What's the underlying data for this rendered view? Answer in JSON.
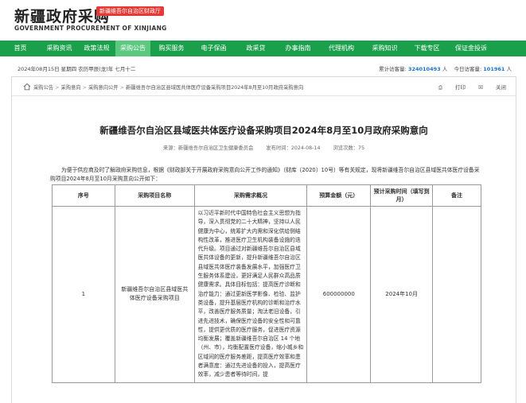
{
  "header": {
    "logo_cn": "新疆政府采购",
    "logo_badge": "新疆维吾尔自治区财政厅",
    "logo_en": "GOVERNMENT PROCUREMENT OF XINJIANG"
  },
  "nav": [
    {
      "label": "首页",
      "active": false
    },
    {
      "label": "采购资讯",
      "active": false
    },
    {
      "label": "政策法规",
      "active": false
    },
    {
      "label": "采购公告",
      "active": true
    },
    {
      "label": "购买服务",
      "active": false
    },
    {
      "label": "电子保函",
      "active": false
    },
    {
      "label": "政采贷",
      "active": false
    },
    {
      "label": "办事指南",
      "active": false
    },
    {
      "label": "代理机构",
      "active": false
    },
    {
      "label": "采购知识",
      "active": false
    },
    {
      "label": "下载专区",
      "active": false
    },
    {
      "label": "保证金投诉",
      "active": false
    }
  ],
  "datebar": {
    "date": "2024年08月15日 星期四 农历甲辰(龙)年 七月十二",
    "total_label": "累计访客量:",
    "total_value": "324010493",
    "total_unit": "人",
    "today_label": "今日访客量:",
    "today_value": "101961",
    "today_unit": "人"
  },
  "breadcrumb": {
    "items": [
      "采购公告",
      "采购意向",
      "采购意向公开",
      "新疆维吾尔自治区县域医共体医疗设备采购项目2024年8月至10月政府采购意向"
    ]
  },
  "tools": {
    "print": "打印",
    "close": "关闭"
  },
  "article": {
    "title": "新疆维吾尔自治区县域医共体医疗设备采购项目2024年8月至10月政府采购意向",
    "source": "来源：新疆维吾尔自治区卫生健康委员会",
    "publish_time": "发布时间：2024-08-14",
    "views": "浏览次数：75",
    "intro": "为便于供应商及时了解政府采购信息，根据《财政部关于开展政府采购意向公开工作的通知》（财库〔2020〕10号）等有关规定，现将新疆维吾尔自治区县域医共体医疗设备采购项目2024年8月至10月采购意向公开如下："
  },
  "table": {
    "headers": [
      "序号",
      "采购项目名称",
      "采购需求概况",
      "预算金额（元）",
      "预计采购时间（填写到月）",
      "备注"
    ],
    "rows": [
      {
        "index": "1",
        "name": "新疆维吾尔自治区县域医共体医疗设备采购项目",
        "summary": "以习近平新时代中国特色社会主义思想为指导，深入贯彻党的二十大精神，坚持以人民健康为中心，统筹扩大内需和深化供给侧结构性改革，推进医疗卫生机构装备设施的迭代升级。项目通过对新疆维吾尔自治区县域医共体设备的更新，提升新疆维吾尔自治区县域医共体医疗装备发展水平，加强医疗卫生服务体系建设，更好满足人民群众高品质健康需求。具体目标包括：提高医疗诊断和治疗能力：通过更新医学影像、检验、监护类设备，提升基层医疗机构的诊断和治疗水平，改善医疗服务质量；淘汰老旧设备，引进先进技术，确保医疗设备的安全性和可靠性，提供更优质的医疗服务，促进医疗资源均衡发展；覆盖新疆维吾尔自治区 14 个地（州、市），均衡配置医疗设备，缩小城乡和区域间的医疗服务差距，提高医疗效率和患者满意度：通过先进设备的投入，提高医疗效率，减少患者等待时间，提",
        "budget": "600000000",
        "time": "2024年10月",
        "note": ""
      }
    ]
  },
  "colors": {
    "nav_bg": "#1aa04b",
    "nav_active": "#5dc87f",
    "badge": "#e53935",
    "counter": "#1a73c9"
  }
}
